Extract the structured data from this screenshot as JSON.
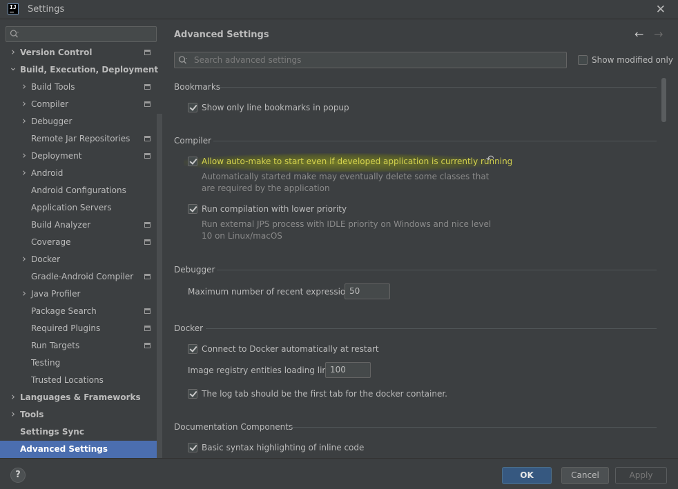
{
  "window": {
    "title": "Settings",
    "close_glyph": "✕"
  },
  "sidebar": {
    "search_placeholder": "",
    "items": [
      {
        "label": "Version Control",
        "level": 0,
        "expandable": true,
        "expanded": false,
        "bold": true,
        "project_icon": true
      },
      {
        "label": "Build, Execution, Deployment",
        "level": 0,
        "expandable": true,
        "expanded": true,
        "bold": true,
        "project_icon": false
      },
      {
        "label": "Build Tools",
        "level": 1,
        "expandable": true,
        "expanded": false,
        "bold": false,
        "project_icon": true
      },
      {
        "label": "Compiler",
        "level": 1,
        "expandable": true,
        "expanded": false,
        "bold": false,
        "project_icon": true
      },
      {
        "label": "Debugger",
        "level": 1,
        "expandable": true,
        "expanded": false,
        "bold": false,
        "project_icon": false
      },
      {
        "label": "Remote Jar Repositories",
        "level": 1,
        "expandable": false,
        "expanded": false,
        "bold": false,
        "project_icon": true
      },
      {
        "label": "Deployment",
        "level": 1,
        "expandable": true,
        "expanded": false,
        "bold": false,
        "project_icon": true
      },
      {
        "label": "Android",
        "level": 1,
        "expandable": true,
        "expanded": false,
        "bold": false,
        "project_icon": false
      },
      {
        "label": "Android Configurations",
        "level": 1,
        "expandable": false,
        "expanded": false,
        "bold": false,
        "project_icon": false
      },
      {
        "label": "Application Servers",
        "level": 1,
        "expandable": false,
        "expanded": false,
        "bold": false,
        "project_icon": false
      },
      {
        "label": "Build Analyzer",
        "level": 1,
        "expandable": false,
        "expanded": false,
        "bold": false,
        "project_icon": true
      },
      {
        "label": "Coverage",
        "level": 1,
        "expandable": false,
        "expanded": false,
        "bold": false,
        "project_icon": true
      },
      {
        "label": "Docker",
        "level": 1,
        "expandable": true,
        "expanded": false,
        "bold": false,
        "project_icon": false
      },
      {
        "label": "Gradle-Android Compiler",
        "level": 1,
        "expandable": false,
        "expanded": false,
        "bold": false,
        "project_icon": true
      },
      {
        "label": "Java Profiler",
        "level": 1,
        "expandable": true,
        "expanded": false,
        "bold": false,
        "project_icon": false
      },
      {
        "label": "Package Search",
        "level": 1,
        "expandable": false,
        "expanded": false,
        "bold": false,
        "project_icon": true
      },
      {
        "label": "Required Plugins",
        "level": 1,
        "expandable": false,
        "expanded": false,
        "bold": false,
        "project_icon": true
      },
      {
        "label": "Run Targets",
        "level": 1,
        "expandable": false,
        "expanded": false,
        "bold": false,
        "project_icon": true
      },
      {
        "label": "Testing",
        "level": 1,
        "expandable": false,
        "expanded": false,
        "bold": false,
        "project_icon": false
      },
      {
        "label": "Trusted Locations",
        "level": 1,
        "expandable": false,
        "expanded": false,
        "bold": false,
        "project_icon": false
      },
      {
        "label": "Languages & Frameworks",
        "level": 0,
        "expandable": true,
        "expanded": false,
        "bold": true,
        "project_icon": false
      },
      {
        "label": "Tools",
        "level": 0,
        "expandable": true,
        "expanded": false,
        "bold": true,
        "project_icon": false
      },
      {
        "label": "Settings Sync",
        "level": 0,
        "expandable": false,
        "expanded": false,
        "bold": true,
        "project_icon": false
      },
      {
        "label": "Advanced Settings",
        "level": 0,
        "expandable": false,
        "expanded": false,
        "bold": true,
        "project_icon": false,
        "selected": true
      }
    ]
  },
  "main": {
    "title": "Advanced Settings",
    "search_placeholder": "Search advanced settings",
    "show_modified_label": "Show modified only",
    "sections": {
      "bookmarks": {
        "title": "Bookmarks",
        "opt1": "Show only line bookmarks in popup"
      },
      "compiler": {
        "title": "Compiler",
        "opt1": "Allow auto-make to start even if developed application is currently running",
        "opt1_desc1": "Automatically started make may eventually delete some classes that",
        "opt1_desc2": "are required by the application",
        "opt2": "Run compilation with lower priority",
        "opt2_desc1": "Run external JPS process with IDLE priority on Windows and nice level",
        "opt2_desc2": "10 on Linux/macOS"
      },
      "debugger": {
        "title": "Debugger",
        "field_label": "Maximum number of recent expressions:",
        "field_value": "50"
      },
      "docker": {
        "title": "Docker",
        "opt1": "Connect to Docker automatically at restart",
        "field_label": "Image registry entities loading limit:",
        "field_value": "100",
        "opt2": "The log tab should be the first tab for the docker container."
      },
      "documentation": {
        "title": "Documentation Components",
        "opt1": "Basic syntax highlighting of inline code"
      }
    }
  },
  "footer": {
    "help": "?",
    "ok": "OK",
    "cancel": "Cancel",
    "apply": "Apply"
  },
  "colors": {
    "background": "#3c3f41",
    "selection": "#4b6eaf",
    "highlight": "#d4d24e",
    "ok_button": "#365880"
  }
}
